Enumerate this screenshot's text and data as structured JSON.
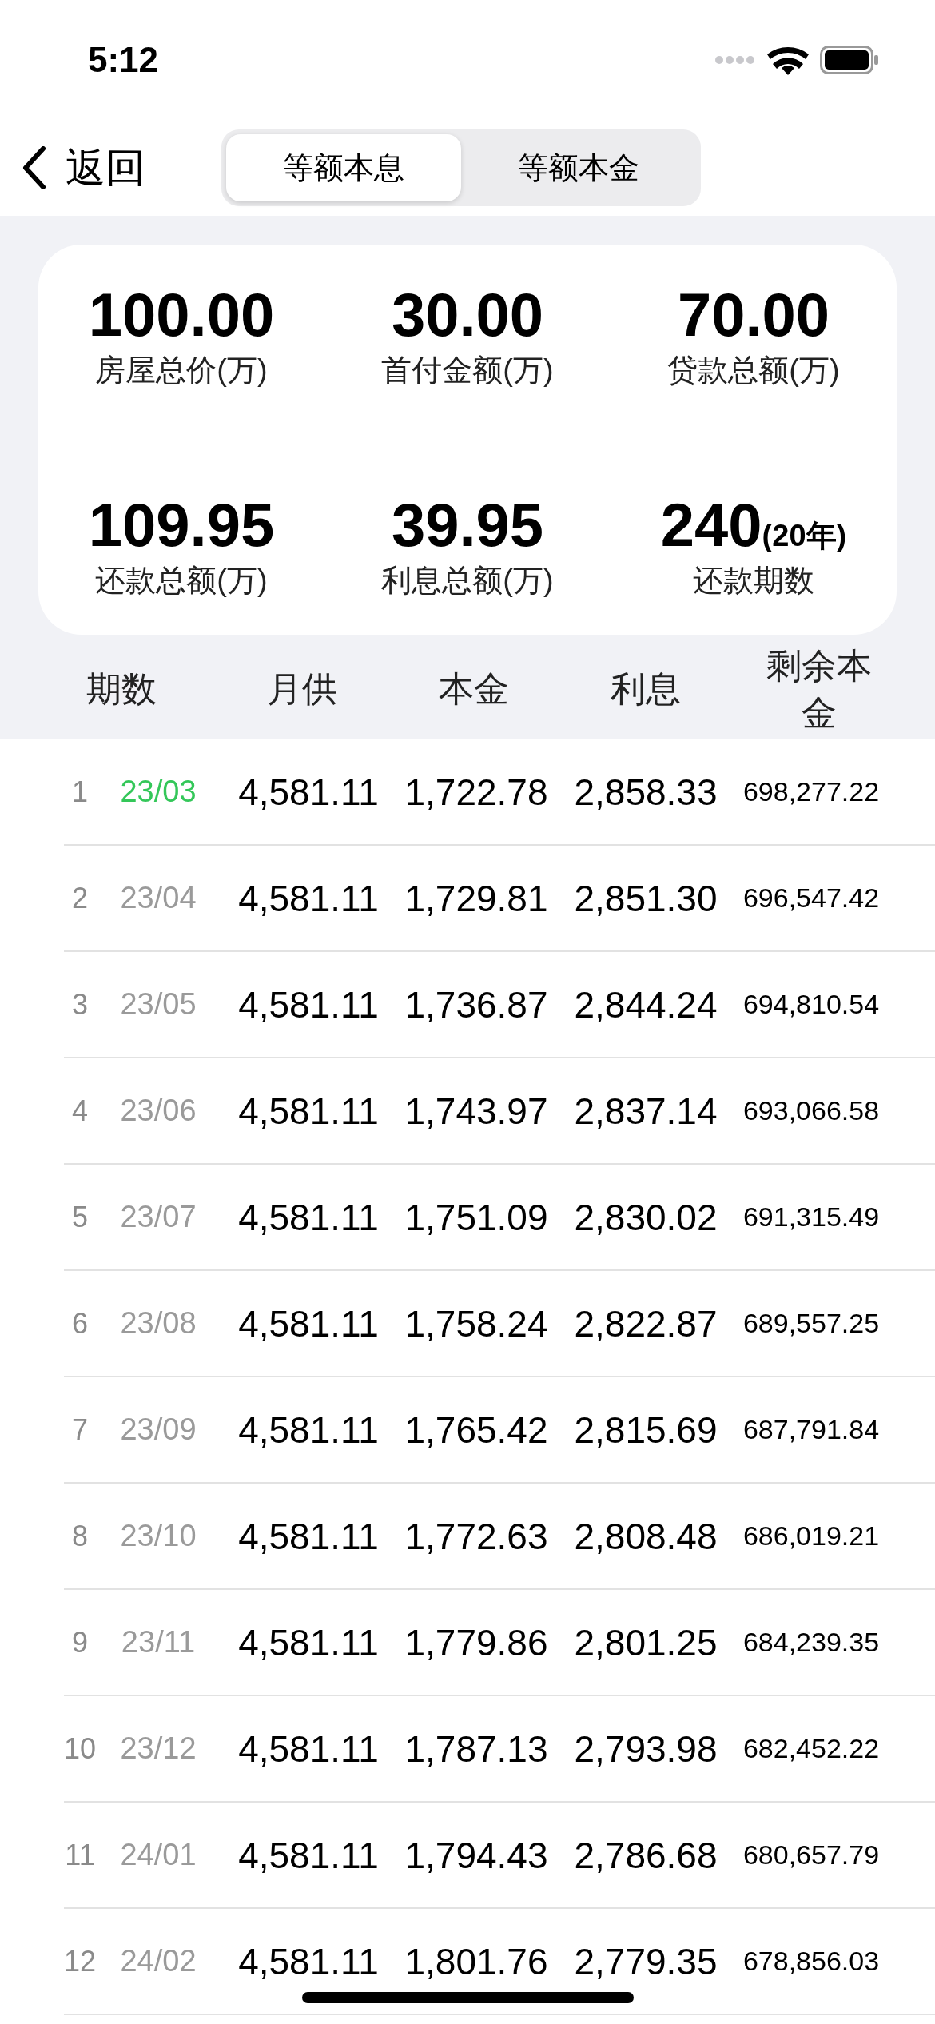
{
  "status_bar": {
    "time": "5:12"
  },
  "nav": {
    "back": "返回",
    "segments": [
      {
        "label": "等额本息",
        "selected": true
      },
      {
        "label": "等额本金",
        "selected": false
      }
    ]
  },
  "summary": [
    {
      "value": "100.00",
      "label": "房屋总价(万)"
    },
    {
      "value": "30.00",
      "label": "首付金额(万)"
    },
    {
      "value": "70.00",
      "label": "贷款总额(万)"
    },
    {
      "value": "109.95",
      "label": "还款总额(万)"
    },
    {
      "value": "39.95",
      "label": "利息总额(万)"
    },
    {
      "value": "240",
      "suffix": "(20年)",
      "label": "还款期数"
    }
  ],
  "table": {
    "columns": [
      "期数",
      "月供",
      "本金",
      "利息",
      "剩余本金"
    ],
    "rows": [
      {
        "period": "1",
        "date": "23/03",
        "current": true,
        "payment": "4,581.11",
        "principal": "1,722.78",
        "interest": "2,858.33",
        "remaining": "698,277.22"
      },
      {
        "period": "2",
        "date": "23/04",
        "current": false,
        "payment": "4,581.11",
        "principal": "1,729.81",
        "interest": "2,851.30",
        "remaining": "696,547.42"
      },
      {
        "period": "3",
        "date": "23/05",
        "current": false,
        "payment": "4,581.11",
        "principal": "1,736.87",
        "interest": "2,844.24",
        "remaining": "694,810.54"
      },
      {
        "period": "4",
        "date": "23/06",
        "current": false,
        "payment": "4,581.11",
        "principal": "1,743.97",
        "interest": "2,837.14",
        "remaining": "693,066.58"
      },
      {
        "period": "5",
        "date": "23/07",
        "current": false,
        "payment": "4,581.11",
        "principal": "1,751.09",
        "interest": "2,830.02",
        "remaining": "691,315.49"
      },
      {
        "period": "6",
        "date": "23/08",
        "current": false,
        "payment": "4,581.11",
        "principal": "1,758.24",
        "interest": "2,822.87",
        "remaining": "689,557.25"
      },
      {
        "period": "7",
        "date": "23/09",
        "current": false,
        "payment": "4,581.11",
        "principal": "1,765.42",
        "interest": "2,815.69",
        "remaining": "687,791.84"
      },
      {
        "period": "8",
        "date": "23/10",
        "current": false,
        "payment": "4,581.11",
        "principal": "1,772.63",
        "interest": "2,808.48",
        "remaining": "686,019.21"
      },
      {
        "period": "9",
        "date": "23/11",
        "current": false,
        "payment": "4,581.11",
        "principal": "1,779.86",
        "interest": "2,801.25",
        "remaining": "684,239.35"
      },
      {
        "period": "10",
        "date": "23/12",
        "current": false,
        "payment": "4,581.11",
        "principal": "1,787.13",
        "interest": "2,793.98",
        "remaining": "682,452.22"
      },
      {
        "period": "11",
        "date": "24/01",
        "current": false,
        "payment": "4,581.11",
        "principal": "1,794.43",
        "interest": "2,786.68",
        "remaining": "680,657.79"
      },
      {
        "period": "12",
        "date": "24/02",
        "current": false,
        "payment": "4,581.11",
        "principal": "1,801.76",
        "interest": "2,779.35",
        "remaining": "678,856.03"
      }
    ]
  }
}
